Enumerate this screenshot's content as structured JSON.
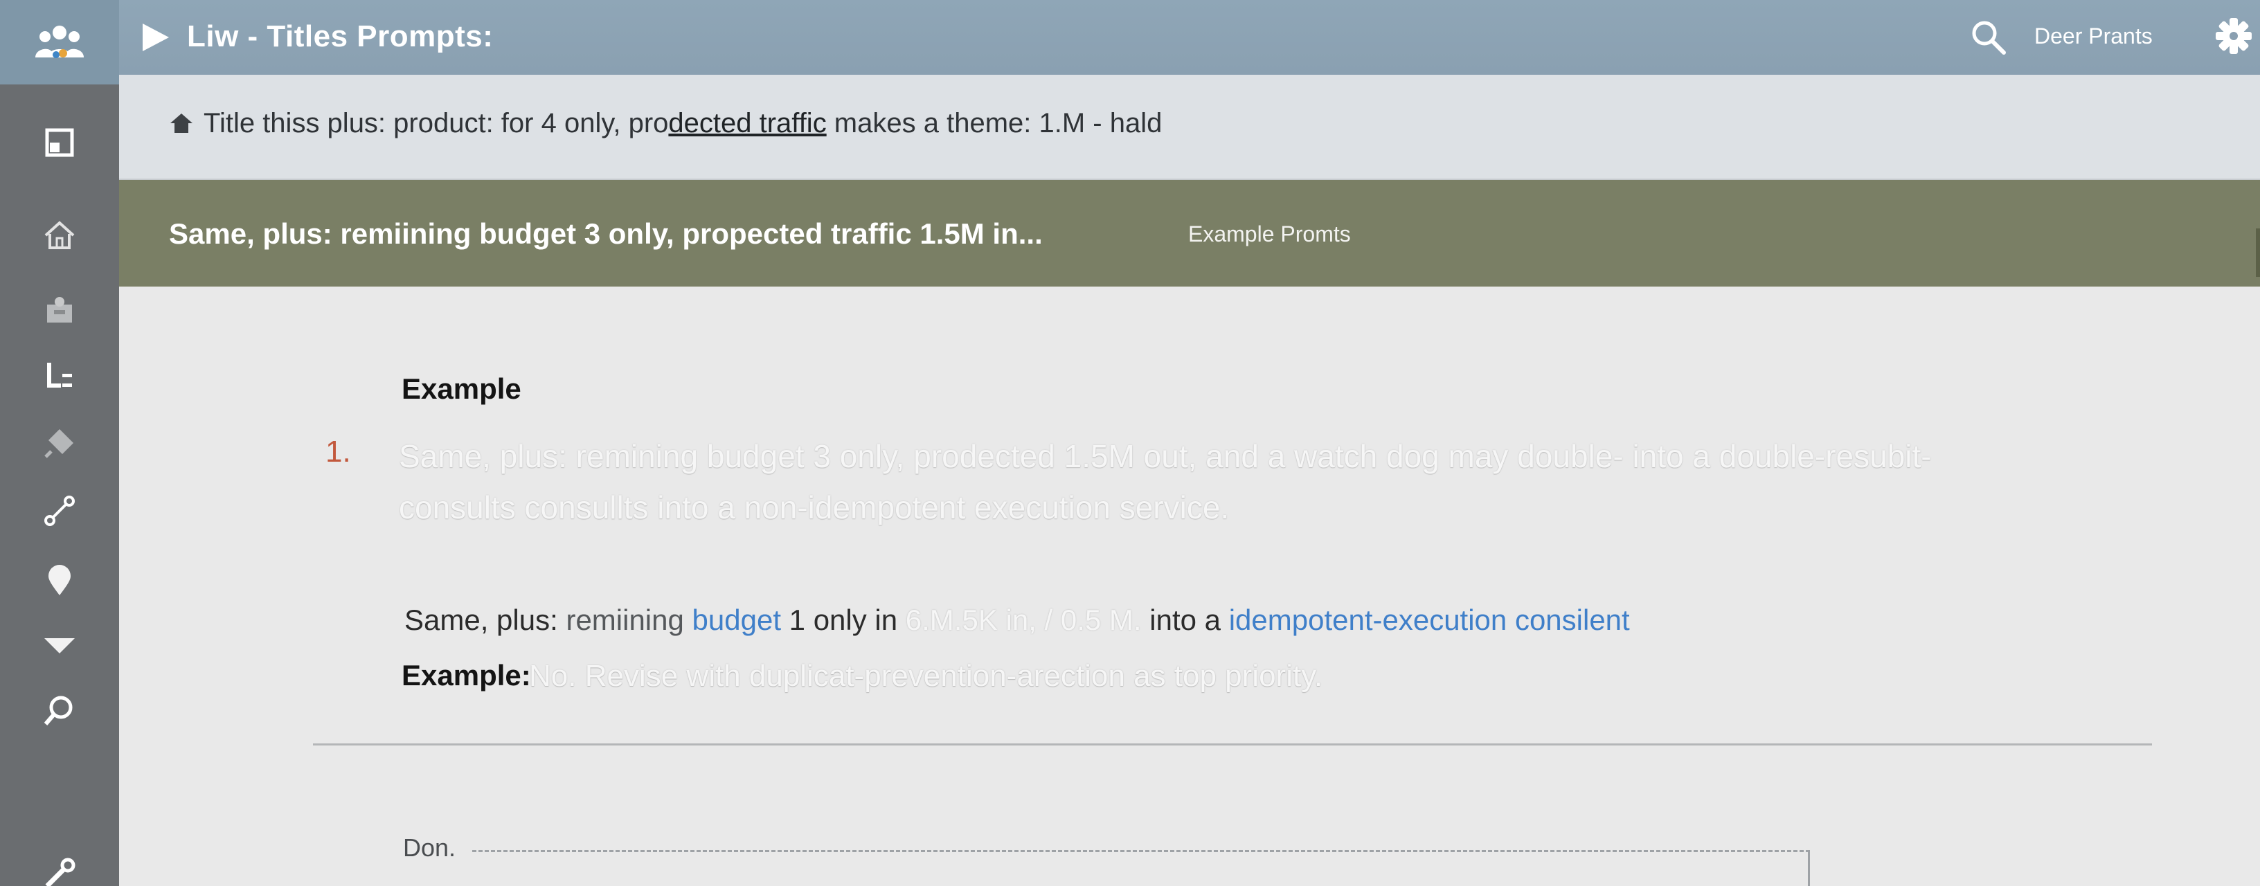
{
  "header": {
    "title": "Liw - Titles Prompts:",
    "user_label": "Deer Prants"
  },
  "breadcrumb": {
    "prefix": "Title  thiss plus:  product: for  4  only, pro",
    "link": "dected traffic",
    "suffix": " makes a theme: 1.M  - hald"
  },
  "banner": {
    "text": "Same, plus:  remiining budget 3 only, propected traffic 1.5M in...",
    "link": "Example Promts"
  },
  "main": {
    "heading": "Example",
    "item_number": "1.",
    "item_text": "Same, plus: remining budget 3 only, prodected 1.5M out, and a watch dog may double- into a double-resubit-consults consullts into a non-idempotent execution service.",
    "line2": {
      "part1": "Same,  plus: ",
      "part2": "remiining ",
      "part3": "budget",
      "part4": " 1 only in ",
      "part5": "6.M.5K in, / 0.5 M.",
      "part6": " into a ",
      "part7": "idempotent-execution consilent"
    },
    "example_label": "Example:",
    "example_text": "No. Revise with duplicat-prevention-arection as top priority.",
    "done_label": "Don."
  },
  "icons": {
    "logo": "users-group-icon",
    "sidebar": [
      "panel-icon",
      "home-icon",
      "inbox-icon",
      "hierarchy-icon",
      "pin-icon",
      "link-icon",
      "location-icon",
      "dropdown-icon",
      "search-icon",
      "tool-icon"
    ]
  },
  "colors": {
    "sidebar": "#6a6d70",
    "topbar": "#8fa6b7",
    "banner": "#7a7f65",
    "number_accent": "#c2583c",
    "link_blue": "#3f7fc9"
  }
}
